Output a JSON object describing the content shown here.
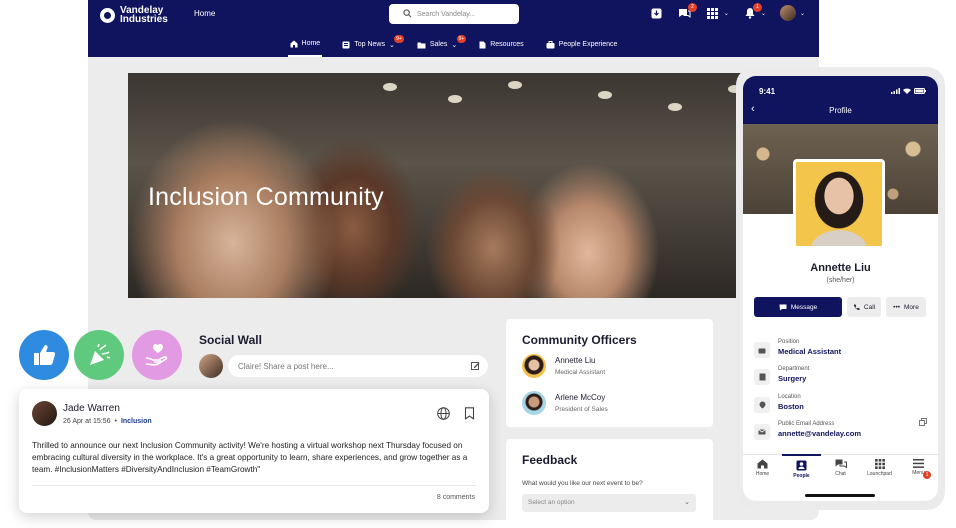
{
  "header": {
    "brand": "Vandelay Industries",
    "home_link": "Home",
    "search_placeholder": "Search Vandelay...",
    "badges": {
      "chat": "2",
      "notifications": "1"
    }
  },
  "nav": {
    "tabs": [
      {
        "label": "Home",
        "badge": ""
      },
      {
        "label": "Top News",
        "badge": "9+"
      },
      {
        "label": "Sales",
        "badge": "9+"
      },
      {
        "label": "Resources",
        "badge": ""
      },
      {
        "label": "People Experience",
        "badge": ""
      }
    ]
  },
  "hero": {
    "title": "Inclusion Community"
  },
  "social_wall": {
    "title": "Social Wall",
    "compose_placeholder": "Claire! Share a post here..."
  },
  "officers": {
    "title": "Community Officers",
    "people": [
      {
        "name": "Annette Liu",
        "role": "Medical Assistant"
      },
      {
        "name": "Arlene McCoy",
        "role": "President of Sales"
      }
    ]
  },
  "feedback": {
    "title": "Feedback",
    "question": "What would you like our next event to be?",
    "select_placeholder": "Select an option"
  },
  "post": {
    "author": "Jade Warren",
    "date": "26 Apr at 15:56",
    "separator": "•",
    "tag": "Inclusion",
    "body": "Thrilled to announce our next Inclusion Community activity! We're hosting a virtual workshop next Thursday focused on embracing cultural diversity in the workplace. It's a great opportunity to learn, share experiences, and grow together as a team. #InclusionMatters #DiversityAndInclusion #TeamGrowth\"",
    "comments": "8 comments"
  },
  "phone": {
    "time": "9:41",
    "title": "Profile",
    "name": "Annette Liu",
    "pronouns": "(she/her)",
    "buttons": {
      "message": "Message",
      "call": "Call",
      "more": "More"
    },
    "fields": [
      {
        "label": "Position",
        "value": "Medical Assistant"
      },
      {
        "label": "Department",
        "value": "Surgery"
      },
      {
        "label": "Location",
        "value": "Boston"
      },
      {
        "label": "Public Email Address",
        "value": "annette@vandelay.com"
      }
    ],
    "nav": [
      {
        "label": "Home"
      },
      {
        "label": "People"
      },
      {
        "label": "Chat"
      },
      {
        "label": "Launchpad"
      },
      {
        "label": "Menu"
      }
    ],
    "menu_badge": "1"
  },
  "colors": {
    "navy": "#10145e",
    "like_blue": "#2f8be0",
    "celebrate_green": "#5fc97e",
    "care_pink": "#e29be2",
    "badge_red": "#e0402a"
  }
}
